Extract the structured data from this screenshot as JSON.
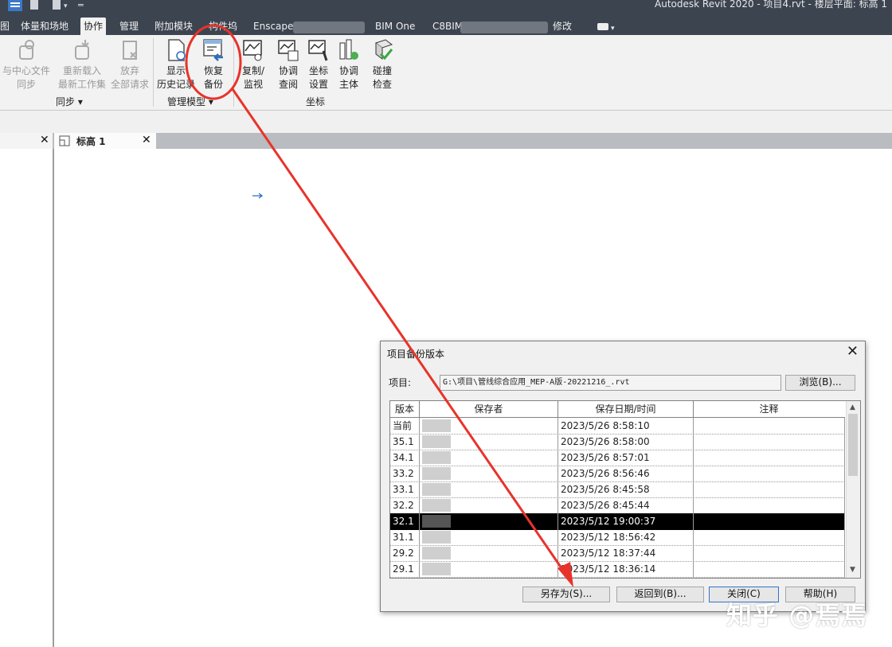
{
  "app": {
    "title": "Autodesk Revit 2020 - 项目4.rvt - 楼层平面: 标高 1"
  },
  "ribbon": {
    "tabs": [
      "图",
      "体量和场地",
      "协作",
      "管理",
      "附加模块",
      "构件坞",
      "Enscape",
      "BIM One",
      "C8BIM",
      "修改"
    ],
    "active_tab": "协作",
    "buttons": {
      "sync_central": [
        "与中心文件",
        "同步"
      ],
      "reload_latest": [
        "重新载入",
        "最新工作集"
      ],
      "relinquish_all": [
        "放弃",
        "全部请求"
      ],
      "show_history": [
        "显示",
        "历史记录"
      ],
      "restore_backup": [
        "恢复",
        "备份"
      ],
      "copy_monitor": [
        "复制/",
        "监视"
      ],
      "coordination_review": [
        "协调",
        "查阅"
      ],
      "coordination_settings": [
        "坐标",
        "设置"
      ],
      "coordination_model": [
        "协调",
        "主体"
      ],
      "interference_check": [
        "碰撞",
        "检查"
      ]
    },
    "panels": {
      "sync": "同步 ▾",
      "manage_models": "管理模型 ▾",
      "coordinate": "坐标"
    }
  },
  "view_tabs": [
    {
      "label": "标高 1"
    }
  ],
  "dialog": {
    "title": "项目备份版本",
    "project_label": "项目:",
    "project_path": "G:\\项目\\管线综合应用_MEP-A版-20221216_.rvt",
    "browse_button": "浏览(B)...",
    "columns": [
      "版本",
      "保存者",
      "保存日期/时间",
      "注释"
    ],
    "rows": [
      {
        "version": "当前",
        "saved_by": "",
        "datetime": "2023/5/26 8:58:10",
        "comment": ""
      },
      {
        "version": "35.1",
        "saved_by": "",
        "datetime": "2023/5/26 8:58:00",
        "comment": ""
      },
      {
        "version": "34.1",
        "saved_by": "",
        "datetime": "2023/5/26 8:57:01",
        "comment": ""
      },
      {
        "version": "33.2",
        "saved_by": "",
        "datetime": "2023/5/26 8:56:46",
        "comment": ""
      },
      {
        "version": "33.1",
        "saved_by": "",
        "datetime": "2023/5/26 8:45:58",
        "comment": ""
      },
      {
        "version": "32.2",
        "saved_by": "",
        "datetime": "2023/5/26 8:45:44",
        "comment": ""
      },
      {
        "version": "32.1",
        "saved_by": "",
        "datetime": "2023/5/12 19:00:37",
        "comment": "",
        "selected": true
      },
      {
        "version": "31.1",
        "saved_by": "",
        "datetime": "2023/5/12 18:56:42",
        "comment": ""
      },
      {
        "version": "29.2",
        "saved_by": "",
        "datetime": "2023/5/12 18:37:44",
        "comment": ""
      },
      {
        "version": "29.1",
        "saved_by": "",
        "datetime": "2023/5/12 18:36:14",
        "comment": ""
      }
    ],
    "buttons": {
      "save_as": "另存为(S)...",
      "rollback": "返回到(B)...",
      "close": "关闭(C)",
      "help": "帮助(H)"
    }
  },
  "watermark": "知乎 @焉焉",
  "colors": {
    "annotation": "#e8332a",
    "selected_row": "#000000",
    "title_bar": "#3c4450",
    "ribbon": "#f2f2f2"
  }
}
